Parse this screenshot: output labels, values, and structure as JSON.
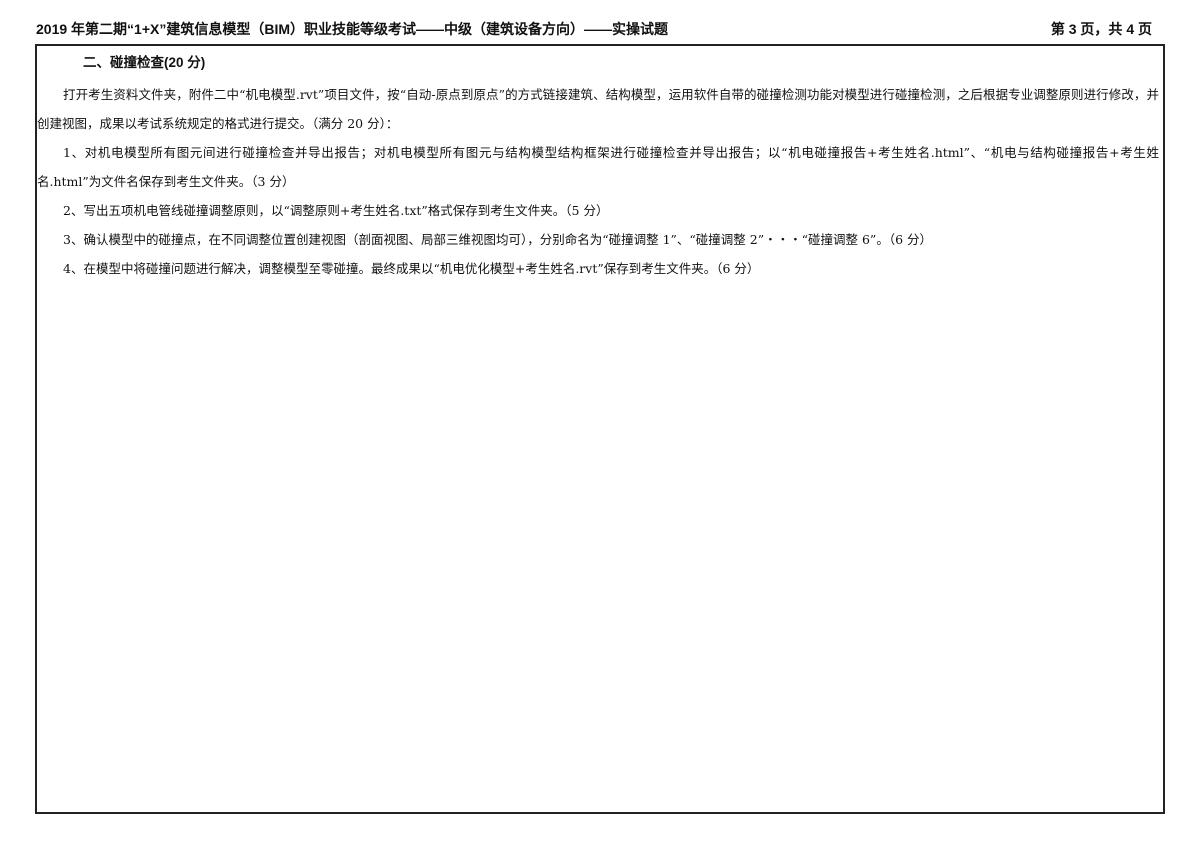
{
  "header": {
    "title": "2019 年第二期“1+X”建筑信息模型（BIM）职业技能等级考试——中级（建筑设备方向）——实操试题",
    "page": "第 3 页，共 4 页"
  },
  "section": {
    "title": "二、碰撞检查(20 分)",
    "intro": "打开考生资料文件夹，附件二中“机电模型.rvt”项目文件，按“自动-原点到原点”的方式链接建筑、结构模型，运用软件自带的碰撞检测功能对模型进行碰撞检测，之后根据专业调整原则进行修改，并创建视图，成果以考试系统规定的格式进行提交。（满分 20 分）：",
    "items": [
      "1、对机电模型所有图元间进行碰撞检查并导出报告；对机电模型所有图元与结构模型结构框架进行碰撞检查并导出报告；以“机电碰撞报告+考生姓名.html”、“机电与结构碰撞报告+考生姓名.html”为文件名保存到考生文件夹。（3 分）",
      "2、写出五项机电管线碰撞调整原则，以“调整原则+考生姓名.txt”格式保存到考生文件夹。（5 分）",
      "3、确认模型中的碰撞点，在不同调整位置创建视图（剖面视图、局部三维视图均可），分别命名为“碰撞调整 1”、“碰撞调整 2”・・・“碰撞调整 6”。（6 分）",
      "4、在模型中将碰撞问题进行解决，调整模型至零碰撞。最终成果以“机电优化模型+考生姓名.rvt”保存到考生文件夹。（6 分）"
    ]
  }
}
